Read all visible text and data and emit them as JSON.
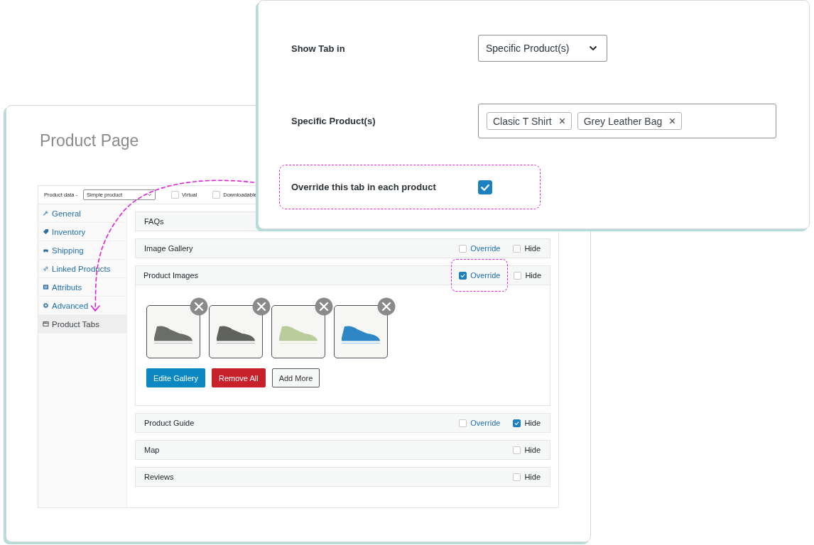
{
  "page_title": "Product Page",
  "product_data": {
    "label": "Product data -",
    "type_select": "Simple product",
    "options": [
      {
        "label": "Virtual",
        "checked": false
      },
      {
        "label": "Downloadable",
        "checked": false
      }
    ]
  },
  "sidebar": {
    "items": [
      {
        "label": "General",
        "kind": "wrench",
        "selected": false
      },
      {
        "label": "Inventory",
        "kind": "tag",
        "selected": false
      },
      {
        "label": "Shipping",
        "kind": "car",
        "selected": false
      },
      {
        "label": "Linked Products",
        "kind": "link",
        "selected": false
      },
      {
        "label": "Attributs",
        "kind": "list",
        "selected": false
      },
      {
        "label": "Advanced",
        "kind": "gear",
        "selected": false
      },
      {
        "label": "Product Tabs",
        "kind": "window",
        "selected": true
      }
    ]
  },
  "tabs": [
    {
      "title": "FAQs",
      "expanded": false
    },
    {
      "title": "Image Gallery",
      "expanded": false,
      "override": {
        "label": "Override",
        "checked": false,
        "highlighted": false
      },
      "hide": {
        "label": "Hide",
        "checked": false
      }
    },
    {
      "title": "Product Images",
      "expanded": true,
      "override": {
        "label": "Override",
        "checked": true,
        "highlighted": true
      },
      "hide": {
        "label": "Hide",
        "checked": false
      },
      "images": [
        {
          "color": "#6b6e68"
        },
        {
          "color": "#5f625d"
        },
        {
          "color": "#b9cc9c"
        },
        {
          "color": "#2f86c4"
        }
      ],
      "buttons": [
        {
          "label": "Edite Gallery",
          "kind": "primary"
        },
        {
          "label": "Remove All",
          "kind": "danger"
        },
        {
          "label": "Add More",
          "kind": "secondary"
        }
      ]
    },
    {
      "title": "Product Guide",
      "expanded": false,
      "override": {
        "label": "Override",
        "checked": false,
        "highlighted": false
      },
      "hide": {
        "label": "Hide",
        "checked": true
      }
    },
    {
      "title": "Map",
      "expanded": false,
      "hide": {
        "label": "Hide",
        "checked": false
      }
    },
    {
      "title": "Reviews",
      "expanded": false,
      "hide": {
        "label": "Hide",
        "checked": false
      }
    }
  ],
  "settings": {
    "show_tab_in": {
      "label": "Show Tab in",
      "value": "Specific Product(s)"
    },
    "specific_products": {
      "label": "Specific Product(s)",
      "tags": [
        "Clasic T Shirt",
        "Grey Leather Bag"
      ]
    },
    "override_each": {
      "label": "Override this tab in each product",
      "checked": true,
      "highlighted": true
    }
  }
}
